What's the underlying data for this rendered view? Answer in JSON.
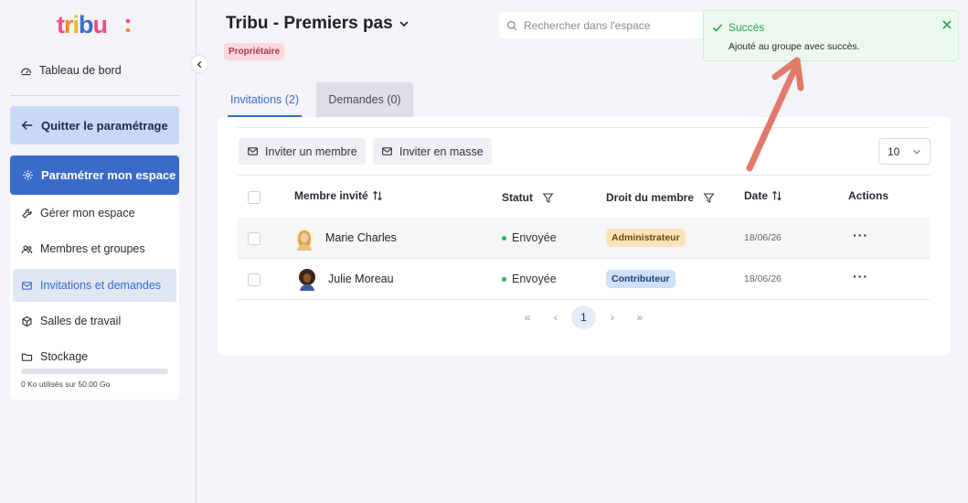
{
  "app": {
    "logo_text": "tribu"
  },
  "sidebar": {
    "dashboard_label": "Tableau de bord",
    "quit_label": "Quitter le paramétrage",
    "setup_label": "Paramétrer mon espace",
    "items": [
      {
        "label": "Gérer mon espace",
        "icon": "wrench-icon"
      },
      {
        "label": "Membres et groupes",
        "icon": "users-icon"
      },
      {
        "label": "Invitations et demandes",
        "icon": "mail-icon",
        "active": true
      },
      {
        "label": "Salles de travail",
        "icon": "cube-icon"
      },
      {
        "label": "Stockage",
        "icon": "folder-icon"
      }
    ],
    "storage": {
      "text": "0 Ko utilisés sur 50.00 Go",
      "used_fraction": 0
    }
  },
  "header": {
    "space_title": "Tribu - Premiers pas",
    "owner_badge": "Propriétaire",
    "search_placeholder": "Rechercher dans l'espace"
  },
  "tabs": [
    {
      "label": "Invitations (2)",
      "active": true
    },
    {
      "label": "Demandes (0)",
      "active": false
    }
  ],
  "toolbar": {
    "invite_member": "Inviter un membre",
    "invite_bulk": "Inviter en masse",
    "per_page": "10"
  },
  "table": {
    "headers": {
      "member": "Membre invité",
      "status": "Statut",
      "role": "Droit du membre",
      "date": "Date",
      "actions": "Actions"
    },
    "rows": [
      {
        "name": "Marie Charles",
        "status": "Envoyée",
        "role": "Administrateur",
        "date": "18/06/26"
      },
      {
        "name": "Julie Moreau",
        "status": "Envoyée",
        "role": "Contributeur",
        "date": "18/06/26"
      }
    ]
  },
  "pagination": {
    "first": "«",
    "prev": "‹",
    "current": "1",
    "next": "›",
    "last": "»"
  },
  "toast": {
    "title": "Succès",
    "message": "Ajouté au groupe avec succès."
  },
  "colors": {
    "primary": "#3a6bc9",
    "success": "#2aa150",
    "owner_badge_bg": "#fbd9de",
    "admin_badge_bg": "#fde3b8",
    "contrib_badge_bg": "#cfe0f8",
    "annotation_arrow": "#e07a6a"
  }
}
